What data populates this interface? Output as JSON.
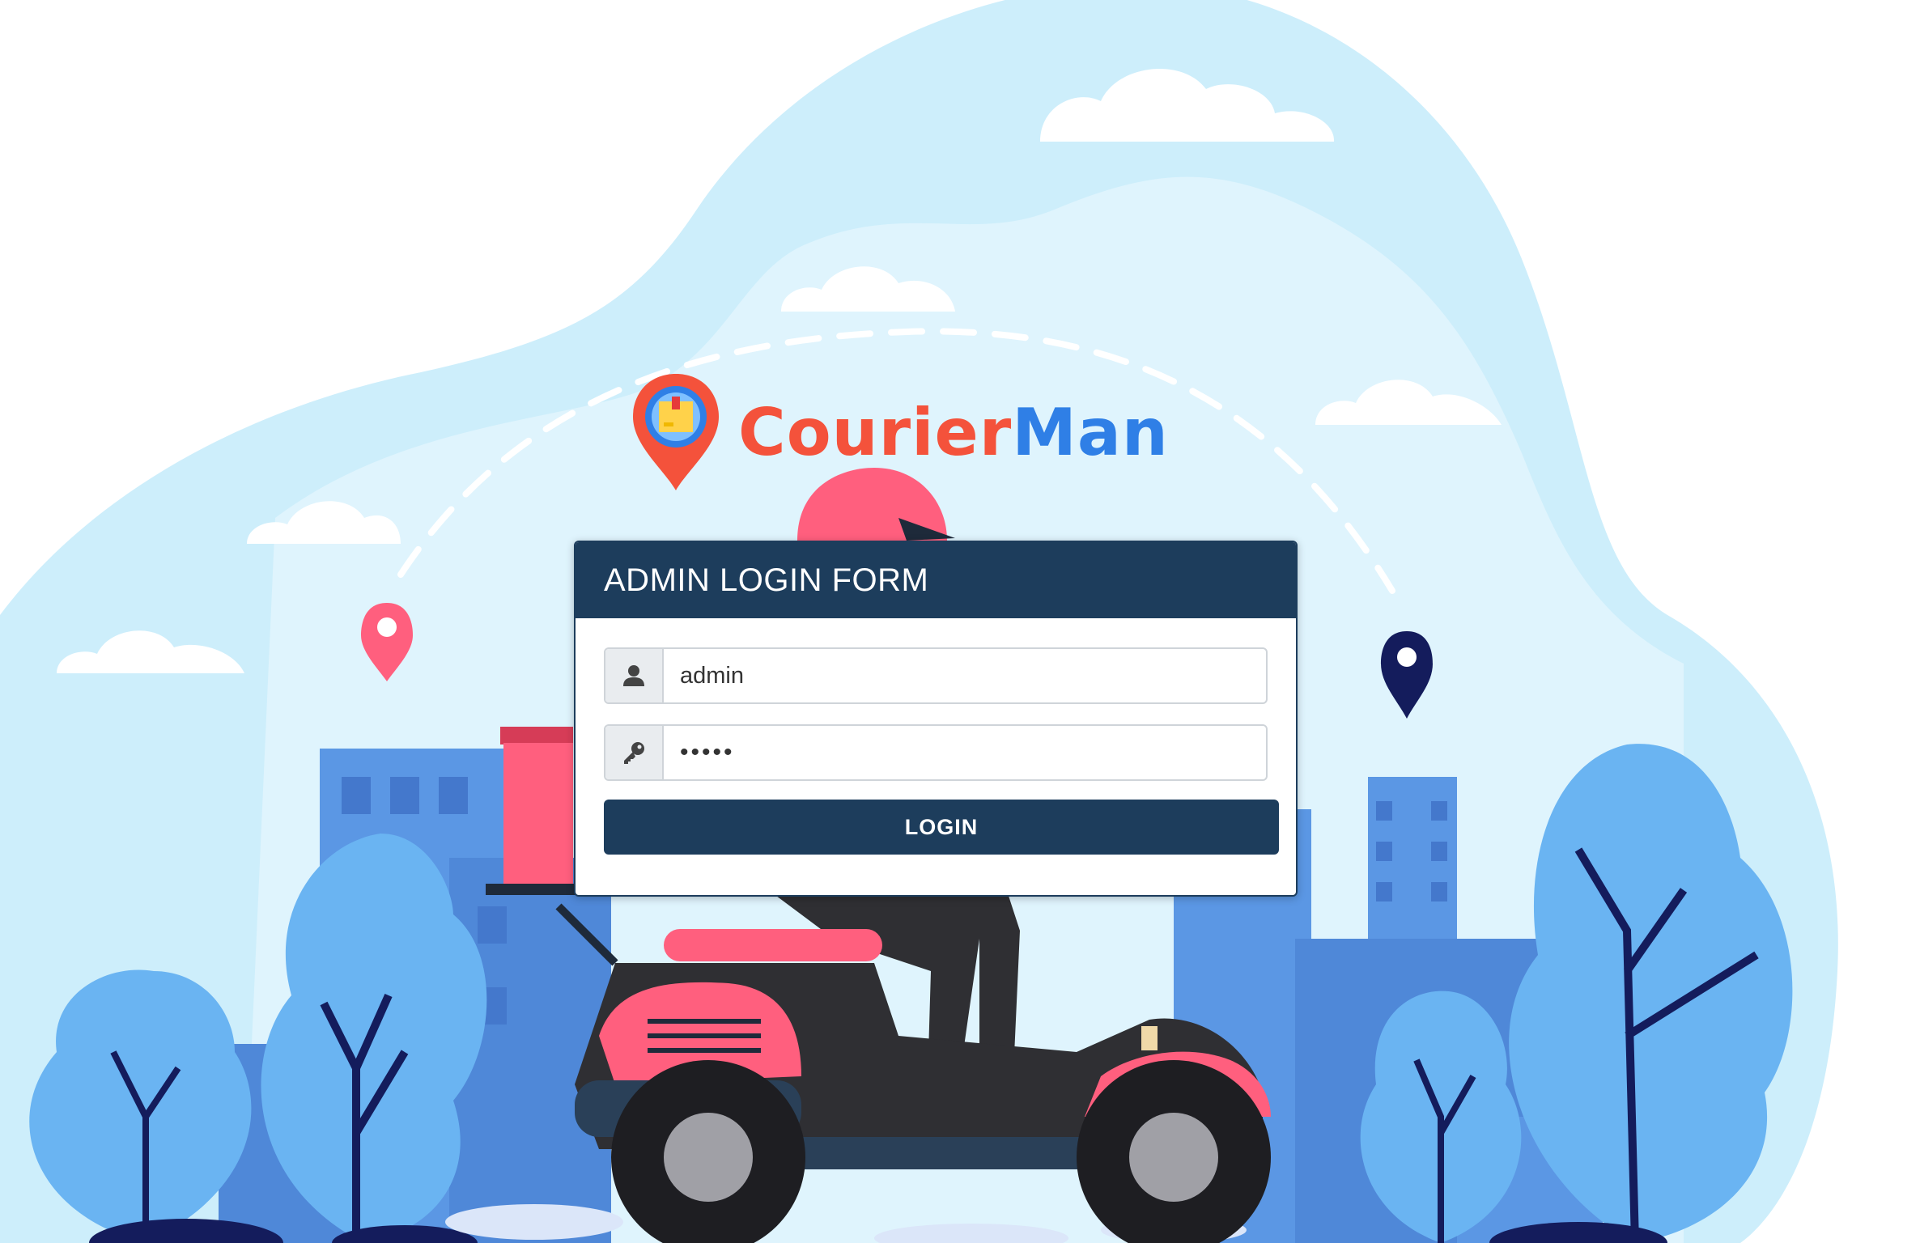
{
  "brand": {
    "name_part1": "Courier",
    "name_part2": "Man",
    "color_part1": "#f4523b",
    "color_part2": "#2f7fe6",
    "logo_icon": "map-pin-with-package-icon"
  },
  "login_form": {
    "title": "ADMIN LOGIN FORM",
    "username": {
      "icon": "user-icon",
      "value": "admin"
    },
    "password": {
      "icon": "key-icon",
      "value": "admin"
    },
    "submit_label": "LOGIN"
  },
  "colors": {
    "panel_header": "#1d3d5c",
    "button": "#1d3d5c",
    "sky": "#cdeefb",
    "accent_pink": "#ff5f7e",
    "accent_blue": "#5b97e4"
  },
  "background": {
    "scene": "delivery-scooter-city-illustration"
  }
}
